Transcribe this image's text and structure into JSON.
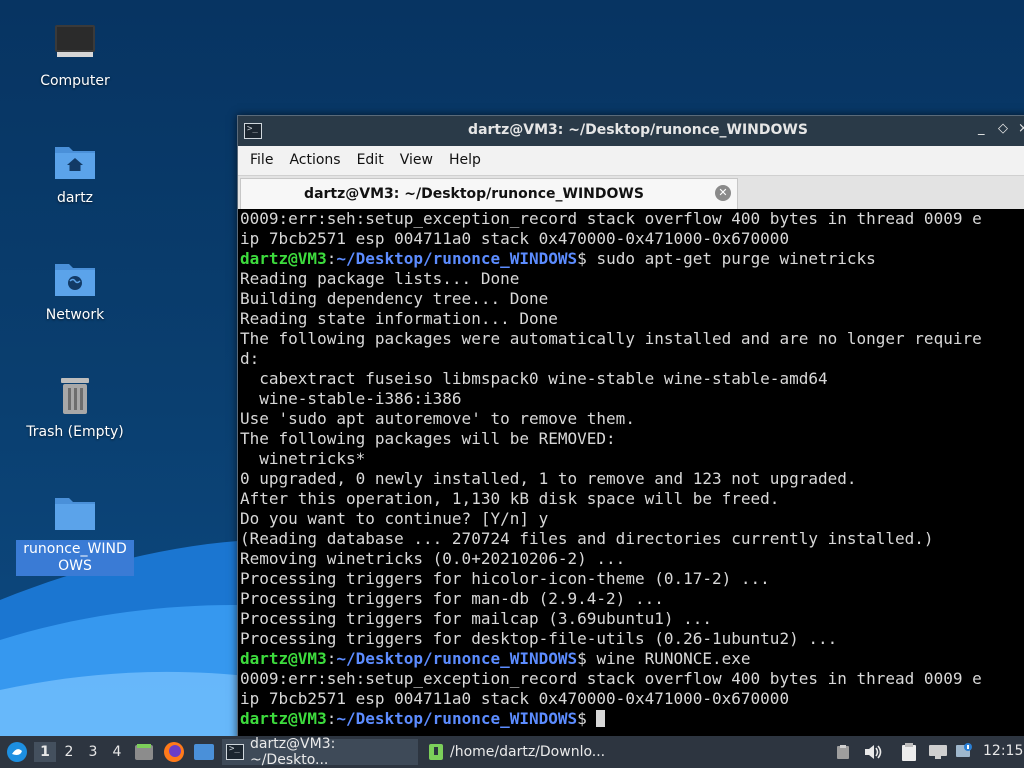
{
  "desktop": {
    "icons": [
      {
        "label": "Computer"
      },
      {
        "label": "dartz"
      },
      {
        "label": "Network"
      },
      {
        "label": "Trash (Empty)"
      },
      {
        "label": "runonce_WINDOWS"
      }
    ]
  },
  "window": {
    "title": "dartz@VM3: ~/Desktop/runonce_WINDOWS",
    "controls": {
      "minimize": "_",
      "maximize": "◇",
      "close": "×"
    }
  },
  "menubar": {
    "items": [
      "File",
      "Actions",
      "Edit",
      "View",
      "Help"
    ]
  },
  "tab": {
    "label": "dartz@VM3: ~/Desktop/runonce_WINDOWS",
    "close": "✕"
  },
  "terminal": {
    "prompt_user": "dartz@VM3",
    "prompt_sep": ":",
    "prompt_path": "~/Desktop/runonce_WINDOWS",
    "prompt_end": "$ ",
    "lines": [
      {
        "text": "0009:err:seh:setup_exception_record stack overflow 400 bytes in thread 0009 e"
      },
      {
        "text": "ip 7bcb2571 esp 004711a0 stack 0x470000-0x471000-0x670000"
      },
      {
        "prompt": true,
        "text": "sudo apt-get purge winetricks"
      },
      {
        "text": "Reading package lists... Done"
      },
      {
        "text": "Building dependency tree... Done"
      },
      {
        "text": "Reading state information... Done"
      },
      {
        "text": "The following packages were automatically installed and are no longer require"
      },
      {
        "text": "d:"
      },
      {
        "text": "  cabextract fuseiso libmspack0 wine-stable wine-stable-amd64"
      },
      {
        "text": "  wine-stable-i386:i386"
      },
      {
        "text": "Use 'sudo apt autoremove' to remove them."
      },
      {
        "text": "The following packages will be REMOVED:"
      },
      {
        "text": "  winetricks*"
      },
      {
        "text": "0 upgraded, 0 newly installed, 1 to remove and 123 not upgraded."
      },
      {
        "text": "After this operation, 1,130 kB disk space will be freed."
      },
      {
        "text": "Do you want to continue? [Y/n] y"
      },
      {
        "text": "(Reading database ... 270724 files and directories currently installed.)"
      },
      {
        "text": "Removing winetricks (0.0+20210206-2) ..."
      },
      {
        "text": "Processing triggers for hicolor-icon-theme (0.17-2) ..."
      },
      {
        "text": "Processing triggers for man-db (2.9.4-2) ..."
      },
      {
        "text": "Processing triggers for mailcap (3.69ubuntu1) ..."
      },
      {
        "text": "Processing triggers for desktop-file-utils (0.26-1ubuntu2) ..."
      },
      {
        "prompt": true,
        "text": "wine RUNONCE.exe"
      },
      {
        "text": "0009:err:seh:setup_exception_record stack overflow 400 bytes in thread 0009 e"
      },
      {
        "text": "ip 7bcb2571 esp 004711a0 stack 0x470000-0x471000-0x670000"
      },
      {
        "prompt": true,
        "text": "",
        "cursor": true
      }
    ]
  },
  "taskbar": {
    "workspaces": [
      "1",
      "2",
      "3",
      "4"
    ],
    "active_workspace": "1",
    "tasks": [
      {
        "label": "dartz@VM3: ~/Deskto..."
      },
      {
        "label": "/home/dartz/Downlo..."
      }
    ],
    "clock": "12:15"
  },
  "colors": {
    "prompt_user": "#3ddc3d",
    "prompt_path": "#5c8cff",
    "terminal_bg": "#000000",
    "selection": "#3a7bd5"
  }
}
